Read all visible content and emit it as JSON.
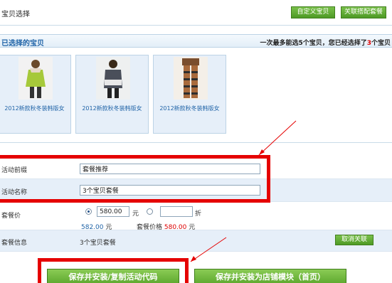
{
  "header": {
    "title": "宝贝选择",
    "custom_button": "自定义宝贝",
    "relate_button": "关联搭配套餐"
  },
  "selected": {
    "title": "已选择的宝贝",
    "hint_prefix": "一次最多能选5个宝贝，您已经选择了",
    "hint_count": "3",
    "hint_suffix": "个宝贝",
    "items": [
      {
        "caption": "2012新款秋冬装韩版女"
      },
      {
        "caption": "2012新款秋冬装韩版女"
      },
      {
        "caption": "2012新款秋冬装韩版女"
      }
    ]
  },
  "form": {
    "prefix_label": "活动前缀",
    "prefix_value": "套餐推荐",
    "name_label": "活动名称",
    "name_value": "3个宝贝套餐",
    "price_label": "套餐价",
    "price_value": "580.00",
    "unit_yuan": "元",
    "discount_value": "",
    "unit_discount": "折",
    "original_price": "582.00",
    "original_unit": "元",
    "package_price_label": "套餐价格",
    "package_price": "580.00",
    "package_unit": "元",
    "info_label": "套餐信息",
    "info_value": "3个宝贝套餐",
    "cancel_link_button": "取消关联"
  },
  "actions": {
    "save_copy": "保存并安装/复制活动代码",
    "save_module": "保存并安装为店铺模块（首页）"
  },
  "colors": {
    "accent_green": "#5aa52b",
    "highlight_red": "#e50000",
    "link_blue": "#1f63a7"
  }
}
